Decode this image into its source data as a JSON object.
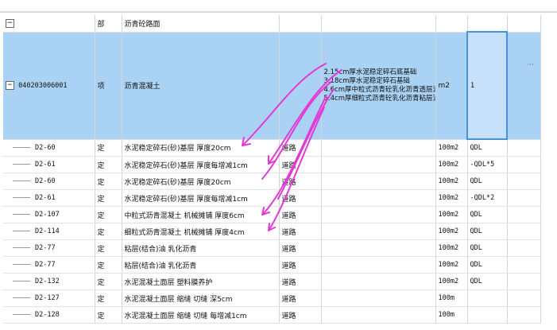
{
  "header_row": {
    "toggle": "−",
    "type": "部",
    "name": "沥青砼路面"
  },
  "selected_item": {
    "toggle": "−",
    "code": "040203006001",
    "type": "项",
    "name": "沥青混凝土",
    "description": "2.15cm厚水泥稳定碎石底基础\n3.18cm厚水泥稳定碎石基础\n4.6cm厚中粒式沥青砼乳化沥青透层油、下封层\n5.4cm厚细粒式沥青砼乳化沥青粘层油",
    "unit": "m2",
    "amount": "1",
    "more": "···"
  },
  "rows": [
    {
      "code": "D2-60",
      "type": "定",
      "name": "水泥稳定碎石(砂)基层 厚度20cm",
      "category": "道路",
      "unit": "100m2",
      "amount": "QDL"
    },
    {
      "code": "D2-61",
      "type": "定",
      "name": "水泥稳定碎石(砂)基层 厚度每增减1cm",
      "category": "道路",
      "unit": "100m2",
      "amount": "-QDL*5"
    },
    {
      "code": "D2-60",
      "type": "定",
      "name": "水泥稳定碎石(砂)基层 厚度20cm",
      "category": "道路",
      "unit": "100m2",
      "amount": "QDL"
    },
    {
      "code": "D2-61",
      "type": "定",
      "name": "水泥稳定碎石(砂)基层 厚度每增减1cm",
      "category": "道路",
      "unit": "100m2",
      "amount": "-QDL*2"
    },
    {
      "code": "D2-107",
      "type": "定",
      "name": "中粒式沥青混凝土 机械摊铺 厚度6cm",
      "category": "道路",
      "unit": "100m2",
      "amount": "QDL"
    },
    {
      "code": "D2-114",
      "type": "定",
      "name": "细粒式沥青混凝土 机械摊铺 厚度4cm",
      "category": "道路",
      "unit": "100m2",
      "amount": "QDL"
    },
    {
      "code": "D2-77",
      "type": "定",
      "name": "粘层(结合)油 乳化沥青",
      "category": "道路",
      "unit": "100m2",
      "amount": "QDL"
    },
    {
      "code": "D2-77",
      "type": "定",
      "name": "粘层(结合)油 乳化沥青",
      "category": "道路",
      "unit": "100m2",
      "amount": "QDL"
    },
    {
      "code": "D2-132",
      "type": "定",
      "name": "水泥混凝土面层 塑料膜养护",
      "category": "道路",
      "unit": "100m2",
      "amount": "QDL"
    },
    {
      "code": "D2-127",
      "type": "定",
      "name": "水泥混凝土面层 缩缝 切缝 深5cm",
      "category": "道路",
      "unit": "100m",
      "amount": ""
    },
    {
      "code": "D2-128",
      "type": "定",
      "name": "水泥混凝土面层 缩缝 切缝 每增减1cm",
      "category": "道路",
      "unit": "100m",
      "amount": ""
    }
  ],
  "colors": {
    "selected_row": "#a9d2f4",
    "annotation": "#e23ad6",
    "border": "#d6d6d6"
  }
}
